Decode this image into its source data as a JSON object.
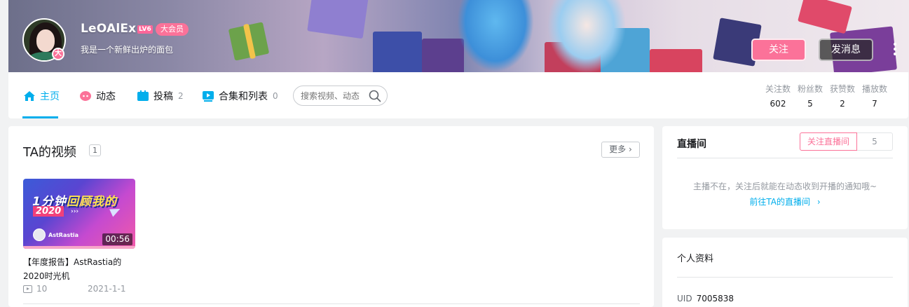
{
  "header": {
    "username": "LeOAlEx",
    "level_badge": "LV6",
    "vip_badge": "大会员",
    "avatar_badge": "大",
    "signature": "我是一个新鲜出炉的面包",
    "follow_label": "关注",
    "message_label": "发消息",
    "more_icon": "more-vertical-icon"
  },
  "nav": {
    "tabs": [
      {
        "label": "主页",
        "icon": "home-icon",
        "count": ""
      },
      {
        "label": "动态",
        "icon": "dynamic-icon",
        "count": ""
      },
      {
        "label": "投稿",
        "icon": "upload-icon",
        "count": "2"
      },
      {
        "label": "合集和列表",
        "icon": "collection-icon",
        "count": "0"
      }
    ],
    "search_placeholder": "搜索视频、动态",
    "stats": [
      {
        "label": "关注数",
        "value": "602"
      },
      {
        "label": "粉丝数",
        "value": "5"
      },
      {
        "label": "获赞数",
        "value": "2"
      },
      {
        "label": "播放数",
        "value": "7"
      }
    ]
  },
  "videos": {
    "title": "TA的视频",
    "count": "1",
    "more_label": "更多",
    "items": [
      {
        "title": "【年度报告】AstRastia的2020时光机",
        "duration": "00:56",
        "plays": "10",
        "date": "2021-1-1",
        "thumb_text_1a": "1分钟",
        "thumb_text_1b": "回顾我的",
        "thumb_text_2": "2020",
        "thumb_arrows": "›››",
        "thumb_owner": "AstRastia"
      }
    ]
  },
  "live": {
    "title": "直播间",
    "follow_label": "关注直播间",
    "follow_count": "5",
    "status_text": "主播不在，关注后就能在动态收到开播的通知哦~",
    "go_text": "前往TA的直播间"
  },
  "profile": {
    "title": "个人资料",
    "uid_label": "UID",
    "uid_value": "7005838"
  },
  "colors": {
    "accent": "#00aeec",
    "pink": "#fb7299"
  }
}
